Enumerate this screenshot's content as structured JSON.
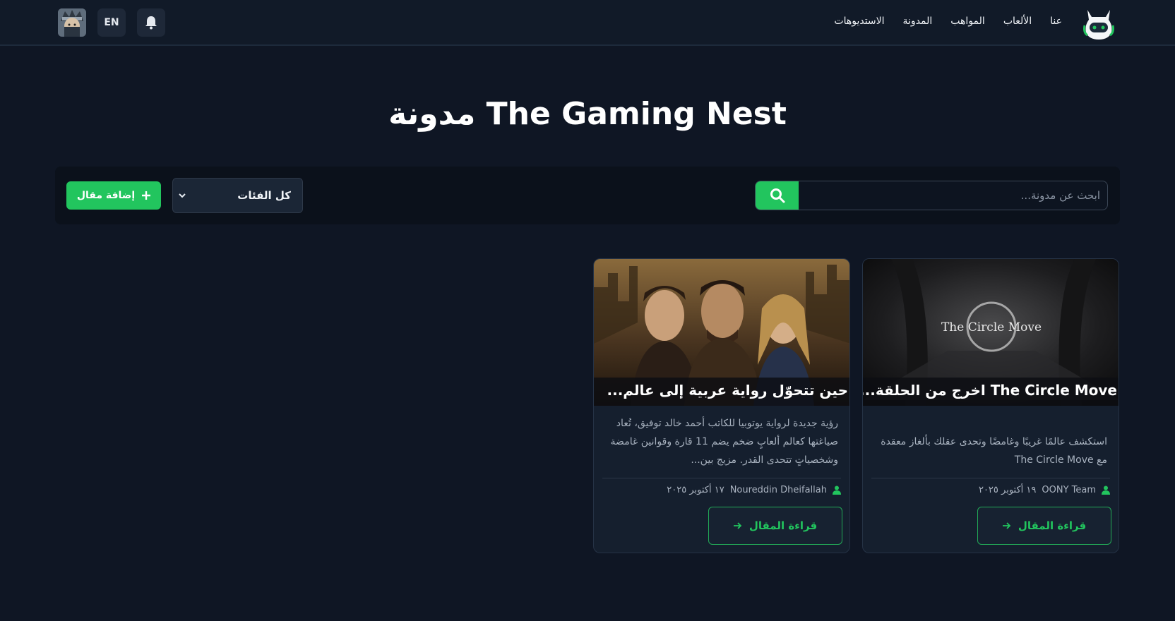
{
  "header": {
    "nav": [
      "عنا",
      "الألعاب",
      "المواهب",
      "المدونة",
      "الاستديوهات"
    ],
    "lang_label": "EN"
  },
  "page": {
    "title": "مدونة The Gaming Nest"
  },
  "filters": {
    "search_placeholder": "ابحث عن مدونة...",
    "category_selected": "كل الفئات",
    "add_label": "إضافة مقال"
  },
  "posts": [
    {
      "title": "The Circle Move اخرج من الحلقة...",
      "image_text": "The Circle Move",
      "description": "استكشف عالمًا غريبًا وغامضًا وتحدى عقلك بألغاز معقدة مع The Circle Move",
      "author": "OONY Team",
      "date": "١٩ أكتوبر ٢٠٢٥",
      "read_label": "قراءة المقال"
    },
    {
      "title": "حين تتحوّل رواية عربية إلى عالم...",
      "description": "رؤية جديدة لرواية يوتوبيا للكاتب أحمد خالد توفيق، تُعاد صياغتها كعالم ألعابٍ ضخم يضم 11 قارة وقوانين غامضة وشخصياتٍ تتحدى القدر. مزيج بين...",
      "author": "Noureddin Dheifallah",
      "date": "١٧ أكتوبر ٢٠٢٥",
      "read_label": "قراءة المقال"
    }
  ],
  "colors": {
    "accent": "#22c55e",
    "background": "#0f1624",
    "card": "#151f2e"
  }
}
